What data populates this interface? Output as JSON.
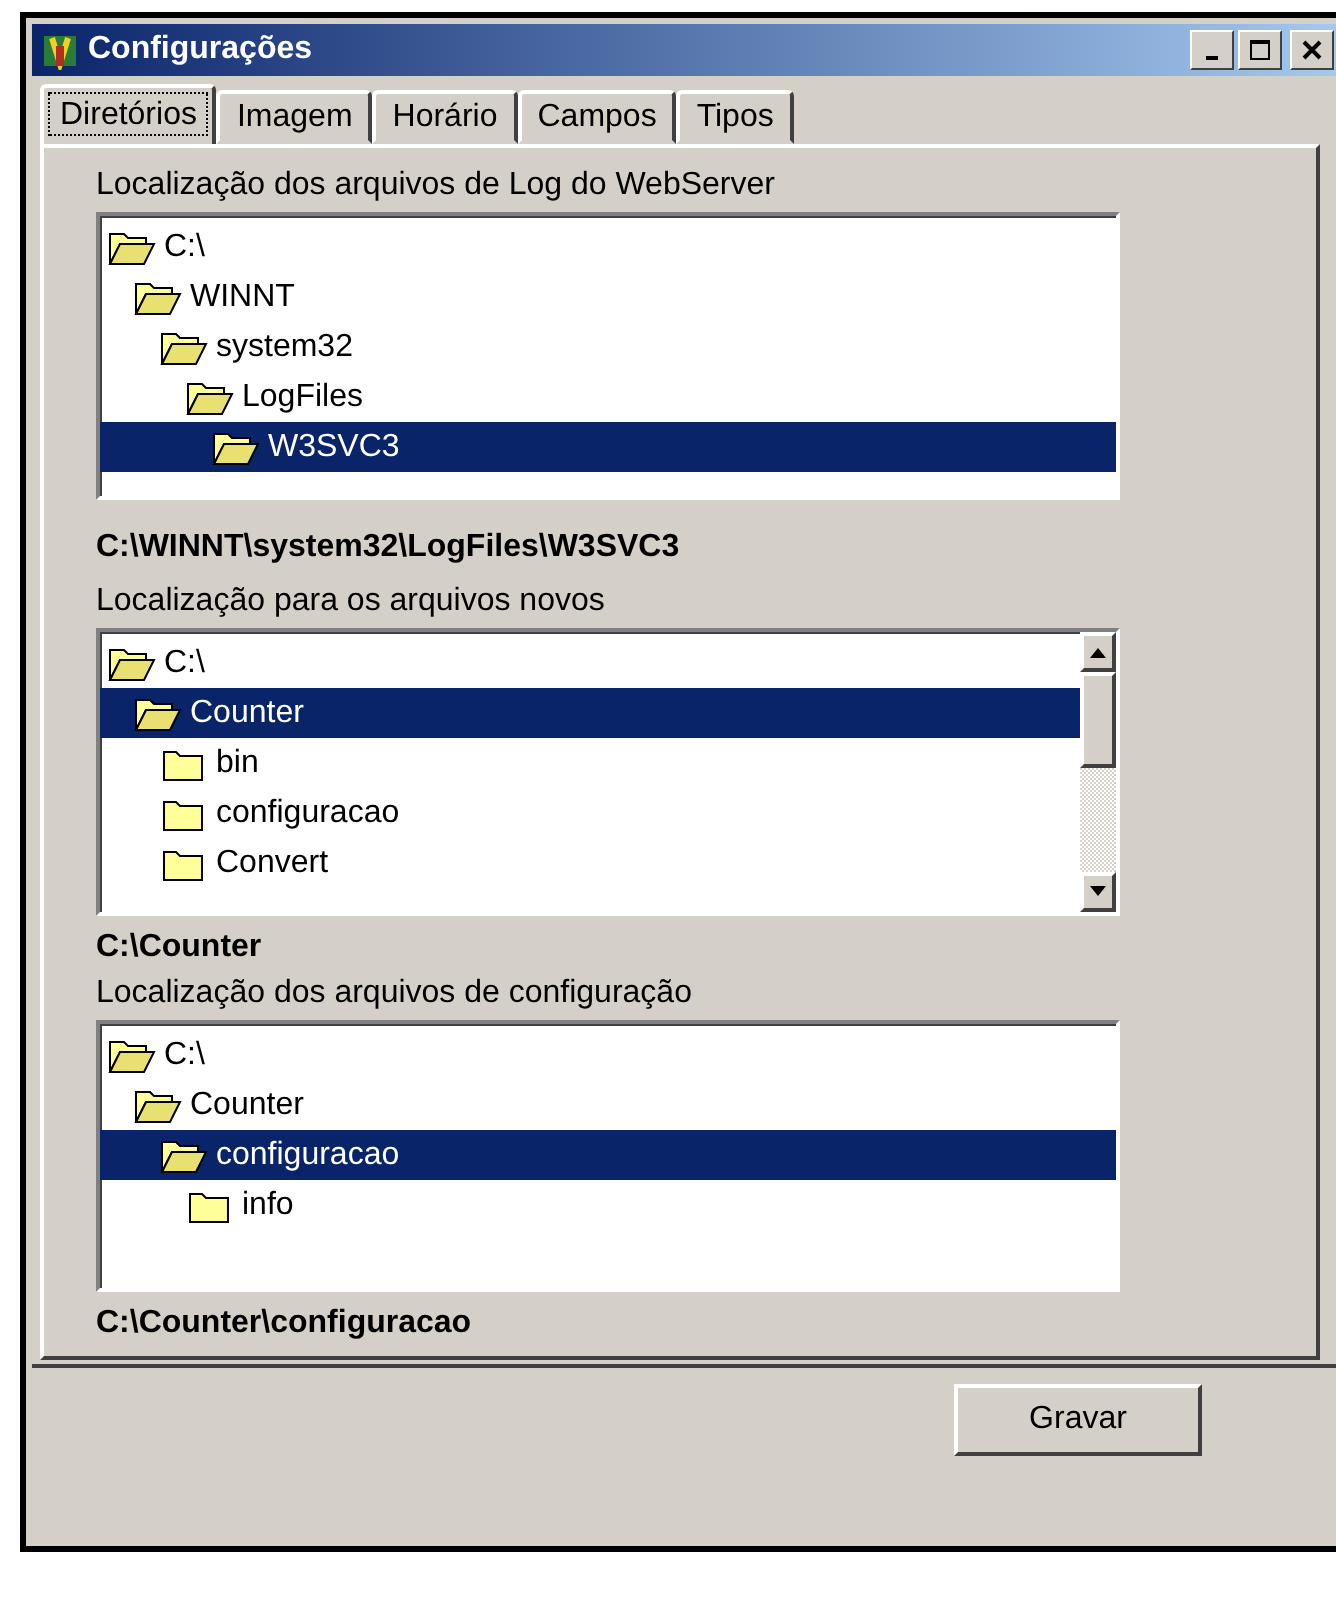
{
  "window": {
    "title": "Configurações"
  },
  "tabs": [
    {
      "label": "Diretórios",
      "selected": true
    },
    {
      "label": "Imagem",
      "selected": false
    },
    {
      "label": "Horário",
      "selected": false
    },
    {
      "label": "Campos",
      "selected": false
    },
    {
      "label": "Tipos",
      "selected": false
    }
  ],
  "sections": [
    {
      "label": "Localização dos arquivos de Log do WebServer",
      "scrollbar": false,
      "tree": [
        {
          "name": "C:\\",
          "open": true,
          "selected": false,
          "children": [
            {
              "name": "WINNT",
              "open": true,
              "selected": false,
              "children": [
                {
                  "name": "system32",
                  "open": true,
                  "selected": false,
                  "children": [
                    {
                      "name": "LogFiles",
                      "open": true,
                      "selected": false,
                      "children": [
                        {
                          "name": "W3SVC3",
                          "open": true,
                          "selected": true
                        }
                      ]
                    }
                  ]
                }
              ]
            }
          ]
        }
      ],
      "path": "C:\\WINNT\\system32\\LogFiles\\W3SVC3"
    },
    {
      "label": "Localização para os arquivos novos",
      "scrollbar": true,
      "tree": [
        {
          "name": "C:\\",
          "open": true,
          "selected": false,
          "children": [
            {
              "name": "Counter",
              "open": true,
              "selected": true,
              "children": [
                {
                  "name": "bin",
                  "open": false,
                  "selected": false
                },
                {
                  "name": "configuracao",
                  "open": false,
                  "selected": false
                },
                {
                  "name": "Convert",
                  "open": false,
                  "selected": false
                }
              ]
            }
          ]
        }
      ],
      "path": "C:\\Counter"
    },
    {
      "label": "Localização dos arquivos de configuração",
      "scrollbar": false,
      "tree": [
        {
          "name": "C:\\",
          "open": true,
          "selected": false,
          "children": [
            {
              "name": "Counter",
              "open": true,
              "selected": false,
              "children": [
                {
                  "name": "configuracao",
                  "open": true,
                  "selected": true,
                  "children": [
                    {
                      "name": "info",
                      "open": false,
                      "selected": false
                    }
                  ]
                }
              ]
            }
          ]
        }
      ],
      "path": "C:\\Counter\\configuracao"
    }
  ],
  "buttons": [
    "Gravar"
  ]
}
